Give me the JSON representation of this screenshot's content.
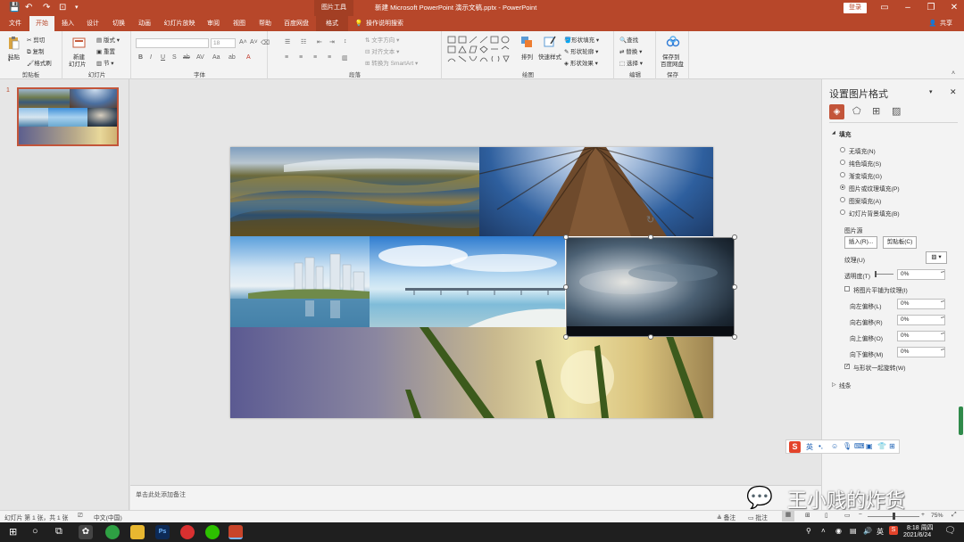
{
  "titlebar": {
    "context_tab": "图片工具",
    "window_title": "新建 Microsoft PowerPoint 演示文稿.pptx - PowerPoint",
    "login": "登录"
  },
  "tabs": [
    "文件",
    "开始",
    "插入",
    "设计",
    "切换",
    "动画",
    "幻灯片放映",
    "审阅",
    "视图",
    "帮助",
    "百度网盘",
    "格式"
  ],
  "tell_me": "操作说明搜索",
  "share": "共享",
  "ribbon": {
    "clipboard": {
      "paste": "粘贴",
      "cut": "剪切",
      "copy": "复制",
      "painter": "格式刷",
      "label": "剪贴板"
    },
    "slides": {
      "new": "新建",
      "new2": "幻灯片",
      "layout": "版式",
      "reset": "重置",
      "section": "节",
      "label": "幻灯片"
    },
    "font": {
      "size": "18",
      "label": "字体"
    },
    "paragraph": {
      "dir": "文字方向",
      "align": "对齐文本",
      "smartart": "转换为 SmartArt",
      "label": "段落"
    },
    "drawing": {
      "arrange": "排列",
      "styles": "快速样式",
      "fill": "形状填充",
      "outline": "形状轮廓",
      "effect": "形状效果",
      "label": "绘图"
    },
    "editing": {
      "find": "查找",
      "replace": "替换",
      "select": "选择",
      "label": "编辑"
    },
    "save": {
      "line1": "保存到",
      "line2": "百度网盘",
      "label": "保存"
    }
  },
  "slide_number": "1",
  "notes_placeholder": "单击此处添加备注",
  "format_pane": {
    "title": "设置图片格式",
    "section_fill": "填充",
    "options": [
      "无填充(N)",
      "纯色填充(S)",
      "渐变填充(G)",
      "图片或纹理填充(P)",
      "图案填充(A)",
      "幻灯片背景填充(B)"
    ],
    "selected_option": 3,
    "picture_source": "图片源",
    "insert_btn": "插入(R)...",
    "clipboard_btn": "剪贴板(C)",
    "texture": "纹理(U)",
    "transparency": "透明度(T)",
    "transparency_value": "0%",
    "tile": "将图片平铺为纹理(I)",
    "offset_left": "向左偏移(L)",
    "offset_right": "向右偏移(R)",
    "offset_top": "向上偏移(O)",
    "offset_bottom": "向下偏移(M)",
    "offset_left_value": "0%",
    "offset_right_value": "0%",
    "offset_top_value": "0%",
    "offset_bottom_value": "0%",
    "rotate": "与形状一起旋转(W)",
    "section_line": "线条"
  },
  "ime": {
    "lang": "英"
  },
  "watermark": "王小贱的炸货",
  "status": {
    "slide_info": "幻灯片 第 1 张，共 1 张",
    "language": "中文(中国)",
    "notes": "备注",
    "comments": "批注",
    "zoom": "75%",
    "zoom_level": 0.5
  },
  "taskbar": {
    "time": "8:18 周四",
    "date": "2021/6/24",
    "ime": "英"
  },
  "colors": {
    "accent": "#b7472a",
    "ribbon": "#f3f3f3",
    "canvas": "#e6e6e6"
  }
}
